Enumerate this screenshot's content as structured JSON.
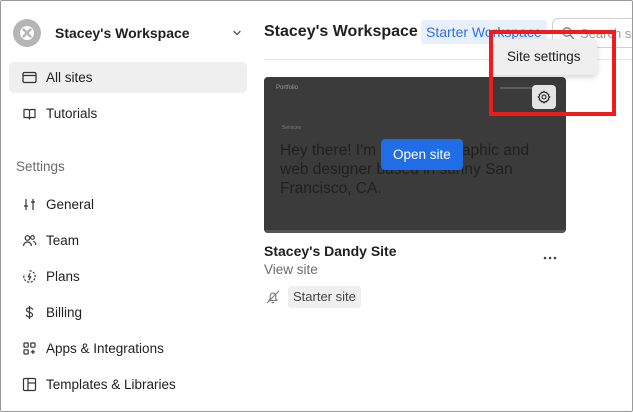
{
  "sidebar": {
    "workspace_name": "Stacey's Workspace",
    "items": [
      {
        "label": "All sites",
        "icon": "browser-window-icon"
      },
      {
        "label": "Tutorials",
        "icon": "book-icon"
      }
    ],
    "settings_label": "Settings",
    "settings_items": [
      {
        "label": "General",
        "icon": "sliders-icon"
      },
      {
        "label": "Team",
        "icon": "team-icon"
      },
      {
        "label": "Plans",
        "icon": "plans-icon"
      },
      {
        "label": "Billing",
        "icon": "dollar-icon"
      },
      {
        "label": "Apps & Integrations",
        "icon": "apps-grid-icon"
      },
      {
        "label": "Templates & Libraries",
        "icon": "templates-icon"
      }
    ]
  },
  "header": {
    "title": "Stacey's Workspace",
    "plan_badge": "Starter Workspace",
    "search_placeholder": "Search sites"
  },
  "site_card": {
    "thumbnail": {
      "logo": "Portfolio",
      "eyebrow": "Services",
      "headline": "Hey there! I'm Stacey, a graphic and web designer based in sunny San Francisco, CA."
    },
    "open_button": "Open site",
    "site_name": "Stacey's Dandy Site",
    "view_link": "View site",
    "plan_chip": "Starter site"
  },
  "tooltip": {
    "text": "Site settings"
  },
  "colors": {
    "accent": "#1f6ee8",
    "badge_text": "#2d6fe6",
    "badge_bg": "#e9f0fd",
    "highlight": "#ee1c1c"
  }
}
